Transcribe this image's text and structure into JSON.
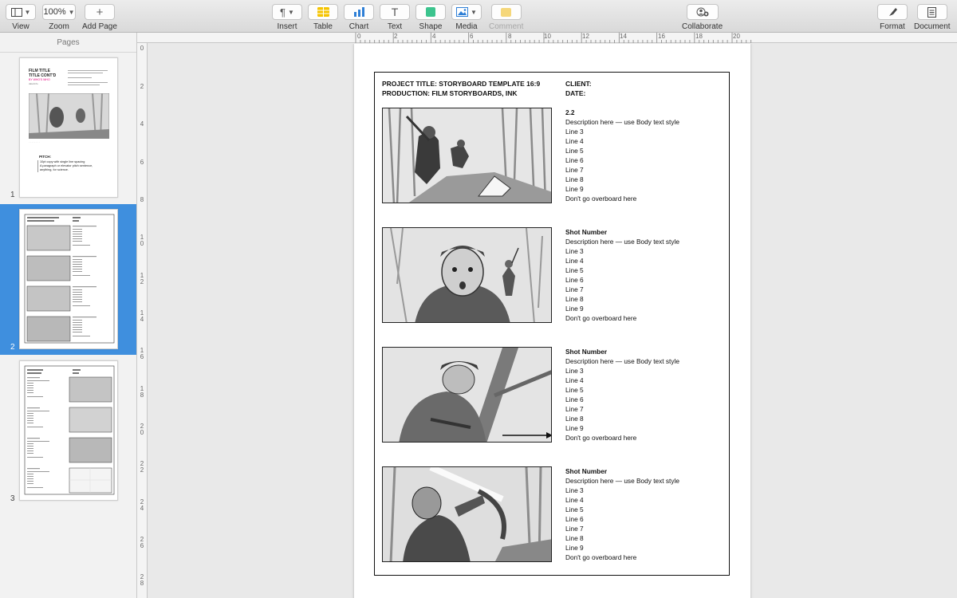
{
  "toolbar": {
    "view_label": "View",
    "zoom_value": "100%",
    "zoom_label": "Zoom",
    "add_page_label": "Add Page",
    "insert_label": "Insert",
    "table_label": "Table",
    "chart_label": "Chart",
    "text_label": "Text",
    "shape_label": "Shape",
    "media_label": "Media",
    "comment_label": "Comment",
    "collaborate_label": "Collaborate",
    "format_label": "Format",
    "document_label": "Document",
    "colors": {
      "table": "#f5c400",
      "chart": "#2e7fd6",
      "shape": "#3cc48e",
      "comment": "#f5d77a"
    }
  },
  "sidebar": {
    "title": "Pages",
    "pages": [
      {
        "number": "1",
        "selected": false
      },
      {
        "number": "2",
        "selected": true
      },
      {
        "number": "3",
        "selected": false
      }
    ],
    "thumb1": {
      "title1": "FILM TITLE",
      "title2": "TITLE CONT'D",
      "byline": "BY WHO'S WHO",
      "date": "date/info",
      "pitch_label": "PITCH:",
      "pitch_lines": [
        "10pt copy with single line spacing",
        "A paragraph or elevator pitch sentence,",
        "anything, for science."
      ]
    }
  },
  "ruler": {
    "h_labels": [
      "0",
      "2",
      "4",
      "6",
      "8",
      "10",
      "12",
      "14",
      "16",
      "18",
      "20"
    ],
    "v_labels": [
      "0",
      "2",
      "4",
      "6",
      "8",
      "1 0",
      "1 2",
      "1 4",
      "1 6",
      "1 8",
      "2 0",
      "2 2",
      "2 4",
      "2 6",
      "2 8"
    ]
  },
  "document": {
    "project_title": "PROJECT TITLE: STORYBOARD TEMPLATE 16:9",
    "production": "PRODUCTION: FILM STORYBOARDS, INK",
    "client": "CLIENT:",
    "date": "DATE:",
    "shots": [
      {
        "title": "2.2",
        "description": "Description here — use Body text style",
        "lines": [
          "Line 3",
          "Line 4",
          "Line 5",
          "Line 6",
          "Line 7",
          "Line 8",
          "Line 9",
          "Don't go overboard here"
        ]
      },
      {
        "title": "Shot Number",
        "description": "Description here — use Body text style",
        "lines": [
          "Line 3",
          "Line 4",
          "Line 5",
          "Line 6",
          "Line 7",
          "Line 8",
          "Line 9",
          "Don't go overboard here"
        ]
      },
      {
        "title": "Shot Number",
        "description": "Description here — use Body text style",
        "lines": [
          "Line 3",
          "Line 4",
          "Line 5",
          "Line 6",
          "Line 7",
          "Line 8",
          "Line 9",
          "Don't go overboard here"
        ]
      },
      {
        "title": "Shot Number",
        "description": "Description here — use Body text style",
        "lines": [
          "Line 3",
          "Line 4",
          "Line 5",
          "Line 6",
          "Line 7",
          "Line 8",
          "Line 9",
          "Don't go overboard here"
        ]
      }
    ]
  }
}
